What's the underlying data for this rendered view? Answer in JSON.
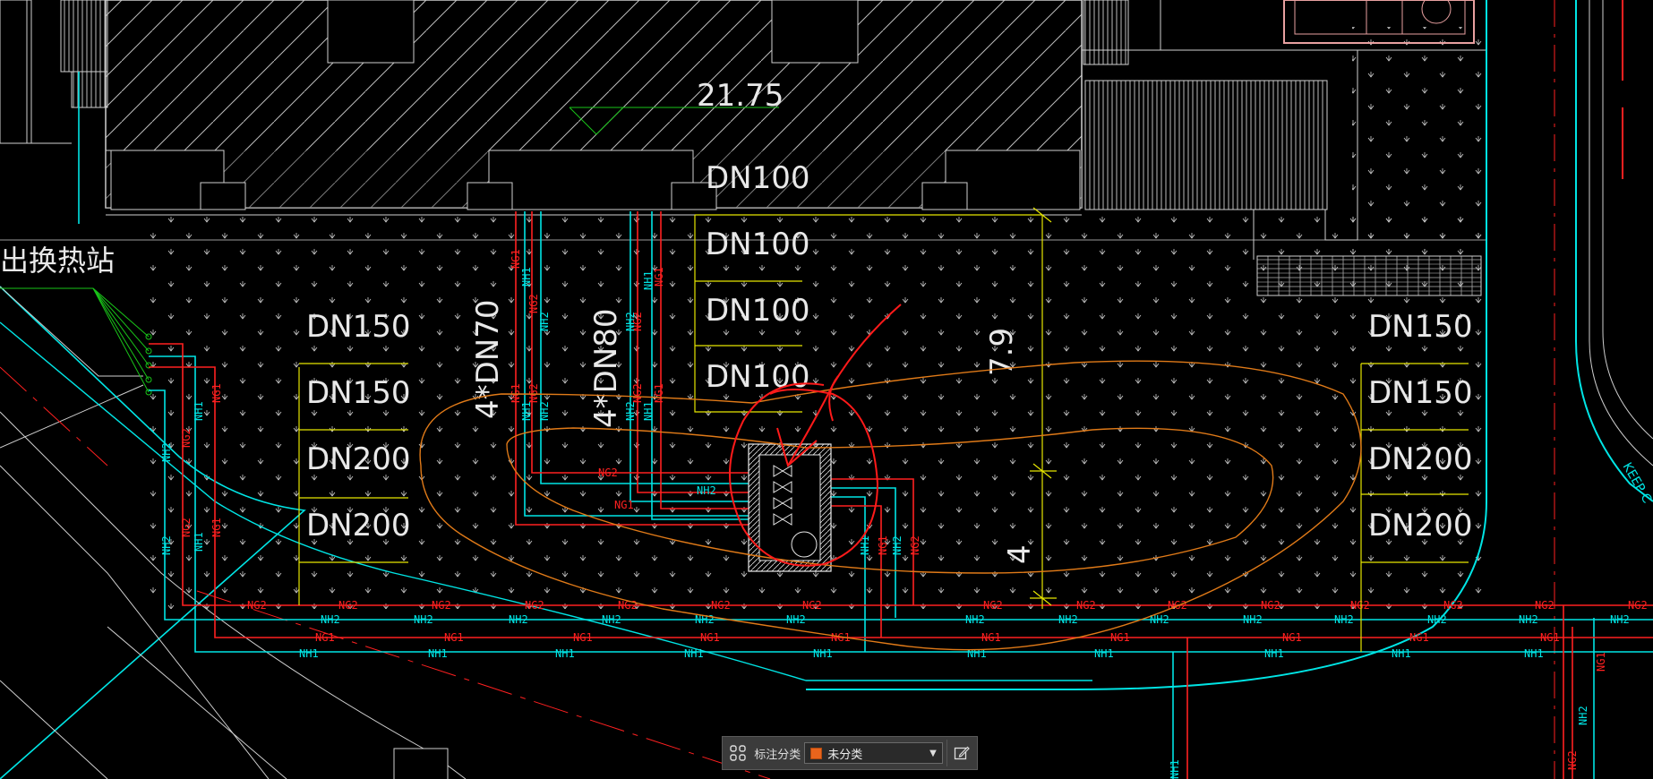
{
  "drawing": {
    "elevation_label": "21.75",
    "station_label": "出换热站",
    "keep_label": "KEEP C",
    "dims": {
      "dim_79": "7.9",
      "dim_4": "4"
    },
    "dn_labels": {
      "top": [
        "DN100",
        "DN100",
        "DN100",
        "DN100"
      ],
      "left": [
        "DN150",
        "DN150",
        "DN200",
        "DN200"
      ],
      "right": [
        "DN150",
        "DN150",
        "DN200",
        "DN200"
      ],
      "riser_a": "4*DN70",
      "riser_b": "4*DN80"
    },
    "pipe_tags": [
      "NG2",
      "NH2",
      "NG1",
      "NH1"
    ]
  },
  "toolbar": {
    "label": "标注分类",
    "category_value": "未分类",
    "swatch_color": "#e8641c"
  },
  "colors": {
    "background": "#000000",
    "cyan_pipe": "#00e5e5",
    "red_pipe": "#ff2020",
    "yellow_line": "#e6e600",
    "white_text": "#e8e8e8",
    "green_line": "#19c419",
    "orange_cloud": "#e07a18",
    "markup_red": "#ff1a1a"
  }
}
